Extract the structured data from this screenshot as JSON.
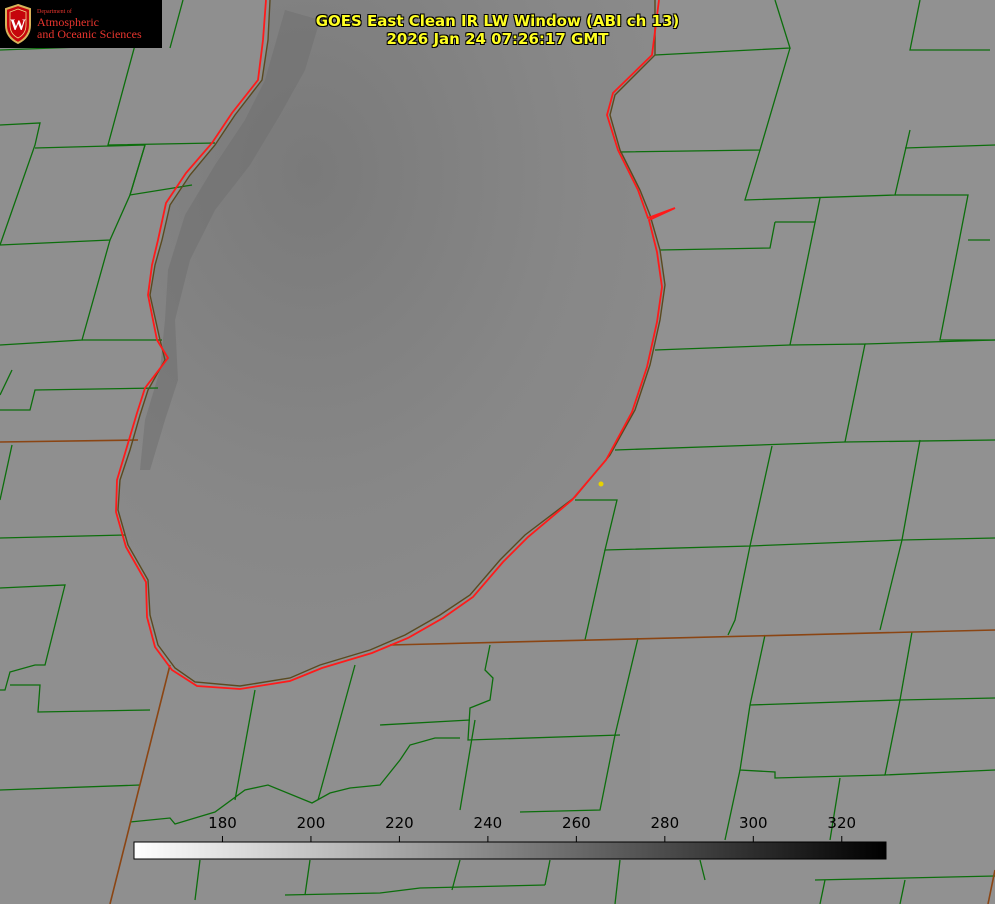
{
  "title": {
    "line1": "GOES East Clean IR LW Window (ABI ch 13)",
    "line2": "2026 Jan 24 07:26:17 GMT"
  },
  "logo": {
    "dept": "Department of",
    "line1": "Atmospheric",
    "line2": "and Oceanic Sciences",
    "seal_letter": "W"
  },
  "colorbar": {
    "min": 160,
    "max": 330,
    "ticks": [
      "180",
      "200",
      "220",
      "240",
      "260",
      "280",
      "300",
      "320"
    ],
    "tick_values": [
      180,
      200,
      220,
      240,
      260,
      280,
      300,
      320
    ],
    "low_color": "#ffffff",
    "high_color": "#000000"
  },
  "colors": {
    "background": "#8e8e8e",
    "county_lines": "#0c6e0c",
    "state_lines": "#8b4513",
    "lake_outline": "#ff1a1a",
    "title_text": "#ffff22",
    "logo_text": "#e8352e",
    "marker": "#e6d200"
  }
}
